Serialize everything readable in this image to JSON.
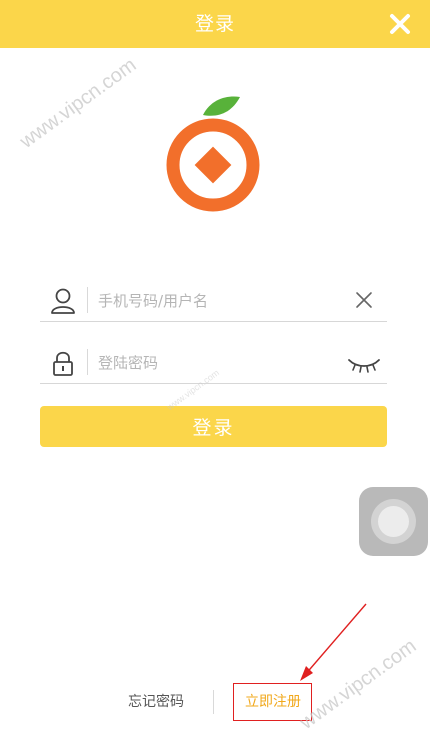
{
  "header": {
    "title": "登录",
    "close_icon": "close-icon"
  },
  "logo": {
    "icon": "orange-coin-logo",
    "colors": {
      "orange": "#f26f2b",
      "leaf": "#58b23a"
    }
  },
  "form": {
    "username": {
      "icon": "user-icon",
      "placeholder": "手机号码/用户名",
      "value": "",
      "clear_icon": "clear-x-icon"
    },
    "password": {
      "icon": "lock-icon",
      "placeholder": "登陆密码",
      "value": "",
      "toggle_icon": "eye-closed-icon"
    },
    "login_label": "登录"
  },
  "assistive_touch": {
    "icon": "assistive-touch-icon"
  },
  "footer": {
    "forgot_label": "忘记密码",
    "register_label": "立即注册"
  },
  "watermark": {
    "text": "www.vipcn.com"
  },
  "colors": {
    "brand": "#fbd64a",
    "register_text": "#f1a81b",
    "annotation_red": "#e02020"
  }
}
